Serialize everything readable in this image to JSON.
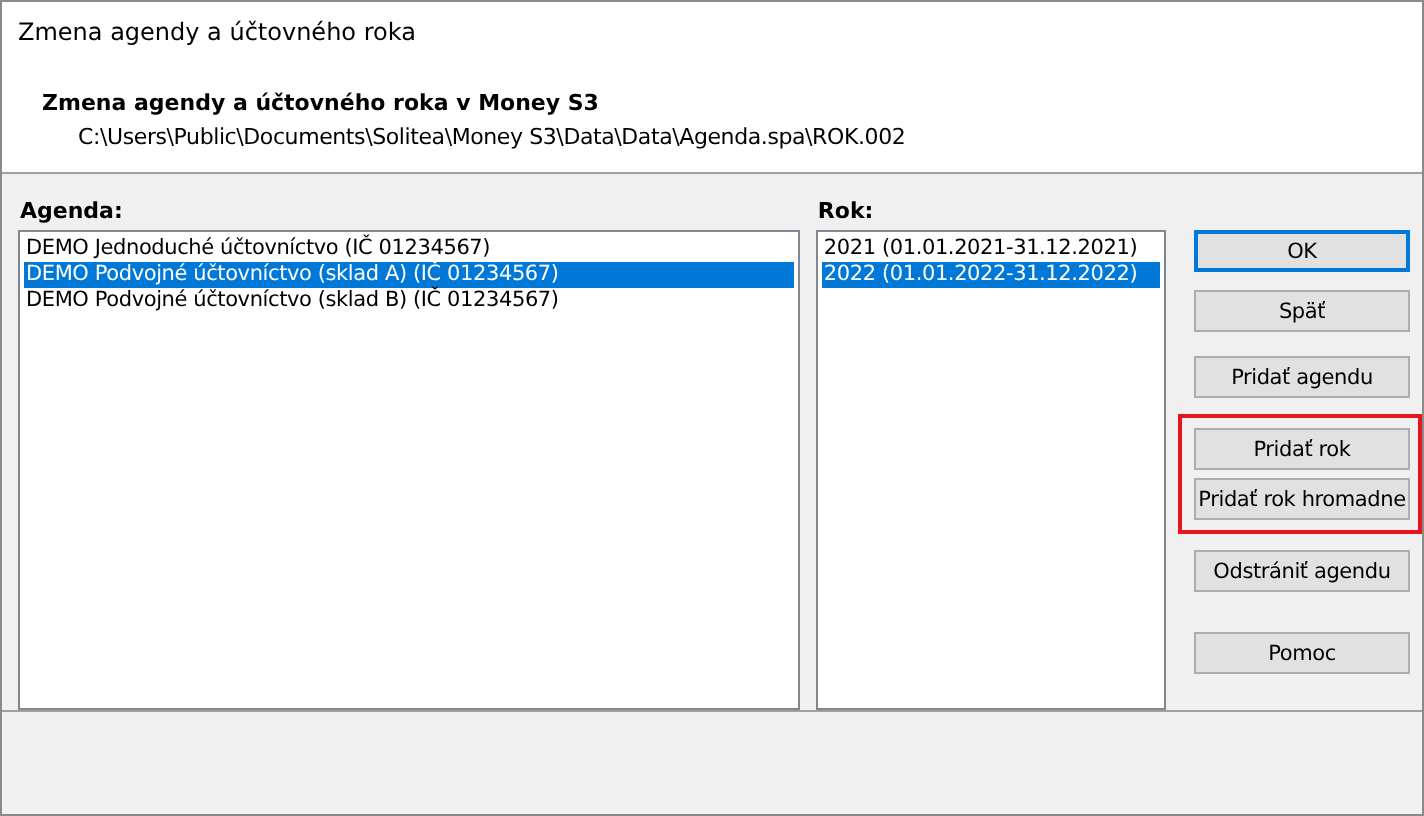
{
  "window": {
    "title": "Zmena agendy a účtovného roka"
  },
  "header": {
    "heading": "Zmena agendy a účtovného roka v Money S3",
    "path": "C:\\Users\\Public\\Documents\\Solitea\\Money S3\\Data\\Data\\Agenda.spa\\ROK.002"
  },
  "agenda": {
    "label": "Agenda:",
    "items": [
      {
        "text": "DEMO Jednoduché účtovníctvo (IČ 01234567)",
        "selected": false
      },
      {
        "text": "DEMO Podvojné účtovníctvo (sklad A) (IČ 01234567)",
        "selected": true
      },
      {
        "text": "DEMO Podvojné účtovníctvo (sklad B) (IČ 01234567)",
        "selected": false
      }
    ]
  },
  "rok": {
    "label": "Rok:",
    "items": [
      {
        "text": "2021 (01.01.2021-31.12.2021)",
        "selected": false
      },
      {
        "text": "2022 (01.01.2022-31.12.2022)",
        "selected": true
      }
    ]
  },
  "button_groups": [
    {
      "highlighted": false,
      "buttons": [
        {
          "label": "OK",
          "default": true
        },
        {
          "label": "Späť",
          "default": false
        }
      ]
    },
    {
      "highlighted": false,
      "buttons": [
        {
          "label": "Pridať agendu",
          "default": false
        }
      ]
    },
    {
      "highlighted": true,
      "buttons": [
        {
          "label": "Pridať rok",
          "default": false
        },
        {
          "label": "Pridať rok hromadne",
          "default": false
        }
      ]
    },
    {
      "highlighted": false,
      "buttons": [
        {
          "label": "Odstrániť agendu",
          "default": false
        }
      ]
    },
    {
      "highlighted": false,
      "buttons": [
        {
          "label": "Pomoc",
          "default": false
        }
      ]
    }
  ]
}
